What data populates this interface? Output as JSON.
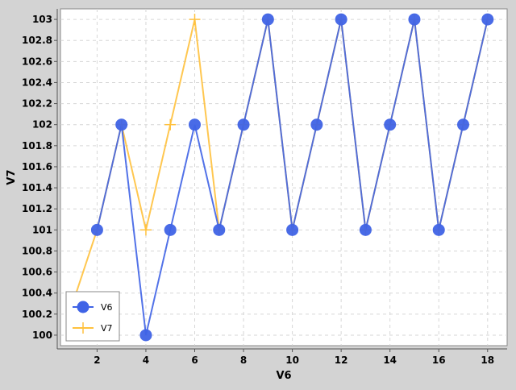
{
  "chart_data": {
    "type": "line",
    "title": "",
    "xlabel": "V6",
    "ylabel": "V7",
    "xlim": [
      0.5,
      18.8
    ],
    "ylim": [
      99.9,
      103.1
    ],
    "xticks": [
      2,
      4,
      6,
      8,
      10,
      12,
      14,
      16,
      18
    ],
    "yticks": [
      100,
      100.2,
      100.4,
      100.6,
      100.8,
      101,
      101.2,
      101.4,
      101.6,
      101.8,
      102,
      102.2,
      102.4,
      102.6,
      102.8,
      103
    ],
    "grid": true,
    "legend_position": "bottom-left",
    "series": [
      {
        "name": "V6",
        "color": "#3f63e6",
        "marker": "circle",
        "x": [
          2,
          3,
          4,
          5,
          6,
          7,
          8,
          9,
          10,
          11,
          12,
          13,
          14,
          15,
          16,
          17,
          18
        ],
        "y": [
          101,
          102,
          100,
          101,
          102,
          101,
          102,
          103,
          101,
          102,
          103,
          101,
          102,
          103,
          101,
          102,
          103
        ]
      },
      {
        "name": "V7",
        "color": "#ffc13d",
        "marker": "plus",
        "x": [
          1,
          2,
          3,
          4,
          5,
          6,
          7,
          8,
          9,
          10,
          11,
          12,
          13,
          14,
          15,
          16,
          17,
          18
        ],
        "y": [
          100.3,
          101,
          102,
          101,
          102,
          103,
          101,
          102,
          103,
          101,
          102,
          103,
          101,
          102,
          103,
          101,
          102,
          103
        ]
      }
    ]
  }
}
